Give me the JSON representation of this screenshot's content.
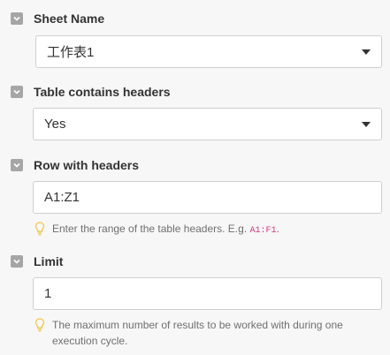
{
  "sheet_name": {
    "label": "Sheet Name",
    "value": "工作表1",
    "icon": "chevron-down-icon"
  },
  "table_contains_headers": {
    "label": "Table contains headers",
    "value": "Yes",
    "icon": "chevron-down-icon"
  },
  "row_with_headers": {
    "label": "Row with headers",
    "value": "A1:Z1",
    "hint_prefix": "Enter the range of the table headers. E.g.",
    "hint_code": "A1:F1",
    "hint_suffix": ".",
    "hint_icon": "lightbulb-icon"
  },
  "limit": {
    "label": "Limit",
    "value": "1",
    "hint": "The maximum number of results to be worked with during one execution cycle.",
    "hint_icon": "lightbulb-icon"
  },
  "colors": {
    "checkbox": "#a6a6a6",
    "code": "#d63384",
    "hint_text": "#6f6f6f",
    "hint_icon": "#f2c94c"
  }
}
